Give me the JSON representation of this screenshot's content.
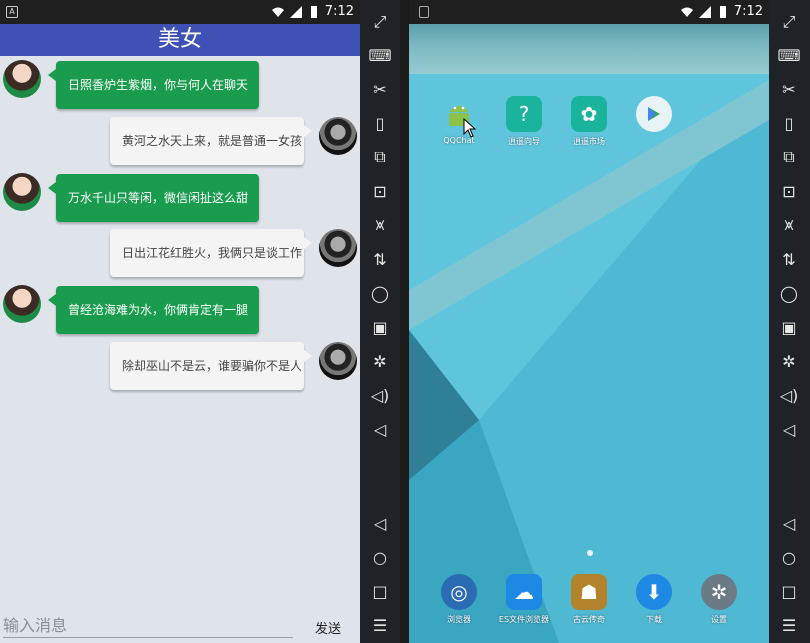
{
  "left_phone": {
    "status_time": "7:12",
    "title": "美女",
    "messages": [
      {
        "side": "in",
        "text": "日照香炉生紫烟，你与何人在聊天"
      },
      {
        "side": "out",
        "text": "黄河之水天上来，就是普通一女孩"
      },
      {
        "side": "in",
        "text": "万水千山只等闲，微信闲扯这么甜"
      },
      {
        "side": "out",
        "text": "日出江花红胜火，我俩只是谈工作"
      },
      {
        "side": "in",
        "text": "曾经沧海难为水，你俩肯定有一腿"
      },
      {
        "side": "out",
        "text": "除却巫山不是云，谁要骗你不是人"
      }
    ],
    "input_placeholder": "输入消息",
    "send_label": "发送"
  },
  "right_phone": {
    "status_time": "7:12",
    "apps": [
      {
        "label": "QQChat",
        "icon": "android-icon",
        "color": "#8bc34a"
      },
      {
        "label": "逍遥向导",
        "icon": "help-icon",
        "color": "#1ab39b"
      },
      {
        "label": "逍遥市场",
        "icon": "market-icon",
        "color": "#1ab39b"
      },
      {
        "label": "",
        "icon": "play-store-icon",
        "color": "#e8f3f6"
      }
    ],
    "dock": [
      {
        "label": "浏览器",
        "icon": "browser-icon",
        "color": "#2a6bb3"
      },
      {
        "label": "ES文件浏览器",
        "icon": "es-file-icon",
        "color": "#1e88e5"
      },
      {
        "label": "古云传奇",
        "icon": "game-icon",
        "color": "#b3832b"
      },
      {
        "label": "下载",
        "icon": "download-icon",
        "color": "#1e88e5"
      },
      {
        "label": "设置",
        "icon": "settings-icon",
        "color": "#6b7b86"
      }
    ]
  },
  "toolbar_icons": [
    "fullscreen-icon",
    "keyboard-icon",
    "scissors-icon",
    "shake-icon",
    "rotate-icon",
    "apk-install-icon",
    "broom-icon",
    "transfer-icon",
    "mouse-icon",
    "record-icon",
    "settings-icon",
    "volume-up-icon",
    "volume-down-icon",
    "back-icon",
    "home-icon",
    "recents-icon",
    "menu-icon"
  ]
}
